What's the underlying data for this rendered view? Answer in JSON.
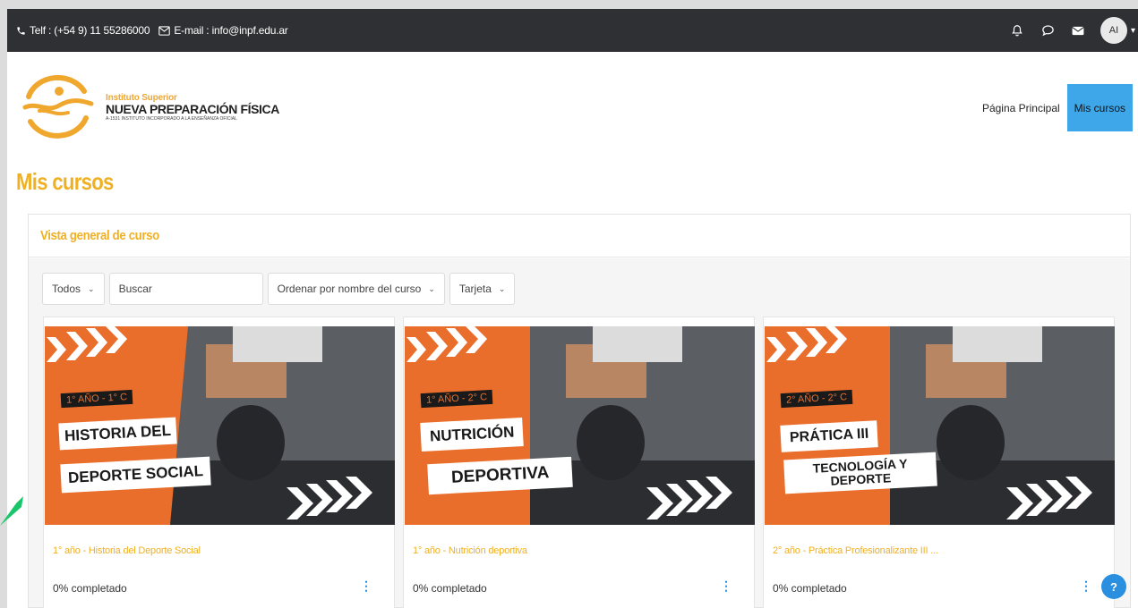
{
  "topbar": {
    "phone": "Telf : (+54 9) 11 55286000",
    "email": "E-mail : info@inpf.edu.ar",
    "avatar": "AI",
    "icons": [
      "phone-icon",
      "mail-outline-icon",
      "bell-icon",
      "chat-icon",
      "envelope-icon"
    ]
  },
  "logo": {
    "line1": "Instituto Superior",
    "line2": "NUEVA PREPARACIÓN FÍSICA",
    "line3": "A-1531  INSTITUTO INCORPORADO A LA ENSEÑANZA OFICIAL"
  },
  "nav": {
    "home": "Página Principal",
    "mycourses": "Mis cursos"
  },
  "page_title": "Mis cursos",
  "block": {
    "title": "Vista general de curso",
    "filters": {
      "todos": "Todos",
      "search_placeholder": "Buscar",
      "sort": "Ordenar por nombre del curso",
      "view": "Tarjeta"
    }
  },
  "courses": [
    {
      "badge": "1° AÑO - 1° C",
      "banner1": "HISTORIA DEL",
      "banner2": "DEPORTE SOCIAL",
      "name": "1° año - Historia del Deporte Social",
      "progress": "0% completado"
    },
    {
      "badge": "1° AÑO - 2° C",
      "banner1": "NUTRICIÓN",
      "banner2": "DEPORTIVA",
      "name": "1° año - Nutrición deportiva",
      "progress": "0% completado"
    },
    {
      "badge": "2° AÑO - 2° C",
      "banner1": "PRÁTICA III",
      "banner2": "TECNOLOGÍA Y DEPORTE",
      "name": "2° año - Práctica Profesionalizante III ...",
      "progress": "0% completado"
    }
  ],
  "help": "?",
  "colors": {
    "accent": "#efb024",
    "nav_active": "#3ea7e9",
    "topbar": "#2f3033",
    "card_orange": "#ea6e2b",
    "link_blue": "#2b8fe0"
  }
}
